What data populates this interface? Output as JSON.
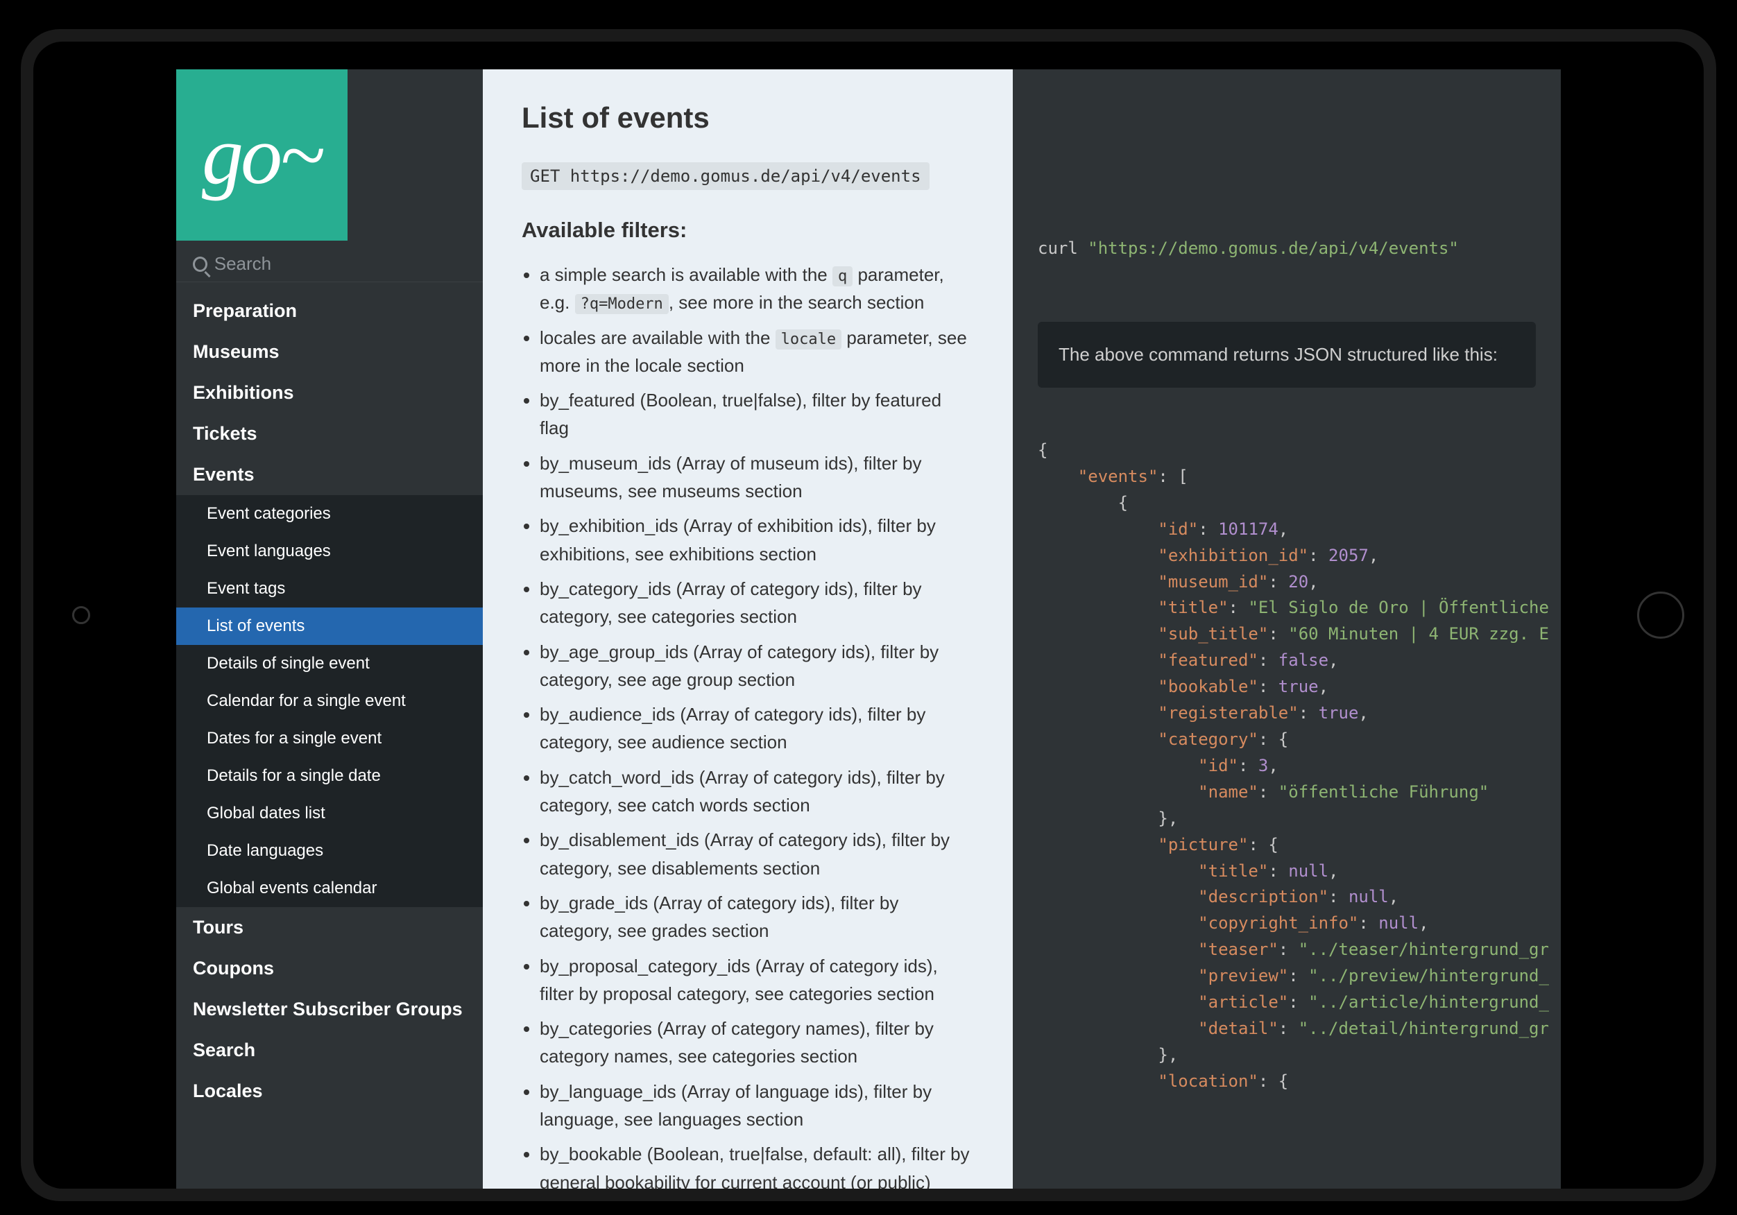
{
  "logo": "go~",
  "search": {
    "placeholder": "Search"
  },
  "nav": {
    "items": [
      {
        "label": "Preparation"
      },
      {
        "label": "Museums"
      },
      {
        "label": "Exhibitions"
      },
      {
        "label": "Tickets"
      },
      {
        "label": "Events",
        "expanded": true,
        "children": [
          {
            "label": "Event categories"
          },
          {
            "label": "Event languages"
          },
          {
            "label": "Event tags"
          },
          {
            "label": "List of events",
            "active": true
          },
          {
            "label": "Details of single event"
          },
          {
            "label": "Calendar for a single event"
          },
          {
            "label": "Dates for a single event"
          },
          {
            "label": "Details for a single date"
          },
          {
            "label": "Global dates list"
          },
          {
            "label": "Date languages"
          },
          {
            "label": "Global events calendar"
          }
        ]
      },
      {
        "label": "Tours"
      },
      {
        "label": "Coupons"
      },
      {
        "label": "Newsletter Subscriber Groups"
      },
      {
        "label": "Search"
      },
      {
        "label": "Locales"
      }
    ]
  },
  "content": {
    "title": "List of events",
    "endpoint": "GET https://demo.gomus.de/api/v4/events",
    "filters_heading": "Available filters:",
    "filters": [
      {
        "html": "a simple search is available with the <code>q</code> parameter, e.g. <code>?q=Modern</code>, see more in the search section"
      },
      {
        "html": "locales are available with the <code>locale</code> parameter, see more in the locale section"
      },
      {
        "html": "by_featured (Boolean, true|false), filter by featured flag"
      },
      {
        "html": "by_museum_ids (Array of museum ids), filter by museums, see museums section"
      },
      {
        "html": "by_exhibition_ids (Array of exhibition ids), filter by exhibitions, see exhibitions section"
      },
      {
        "html": "by_category_ids (Array of category ids), filter by category, see categories section"
      },
      {
        "html": "by_age_group_ids (Array of category ids), filter by category, see age group section"
      },
      {
        "html": "by_audience_ids (Array of category ids), filter by category, see audience section"
      },
      {
        "html": "by_catch_word_ids (Array of category ids), filter by category, see catch words section"
      },
      {
        "html": "by_disablement_ids (Array of category ids), filter by category, see disablements section"
      },
      {
        "html": "by_grade_ids (Array of category ids), filter by category, see grades section"
      },
      {
        "html": "by_proposal_category_ids (Array of category ids), filter by proposal category, see categories section"
      },
      {
        "html": "by_categories (Array of category names), filter by category names, see categories section"
      },
      {
        "html": "by_language_ids (Array of language ids), filter by language, see languages section"
      },
      {
        "html": "by_bookable (Boolean, true|false, default: all), filter by general bookability for current account (or public)"
      }
    ]
  },
  "code": {
    "curl_cmd": "curl ",
    "curl_url": "\"https://demo.gomus.de/api/v4/events\"",
    "note": "The above command returns JSON structured like this:",
    "json_tokens": [
      {
        "t": "{",
        "c": "p"
      },
      {
        "nl": 1
      },
      {
        "i": 4
      },
      {
        "t": "\"events\"",
        "c": "k"
      },
      {
        "t": ": [",
        "c": "p"
      },
      {
        "nl": 1
      },
      {
        "i": 8
      },
      {
        "t": "{",
        "c": "p"
      },
      {
        "nl": 1
      },
      {
        "i": 12
      },
      {
        "t": "\"id\"",
        "c": "k"
      },
      {
        "t": ": ",
        "c": "p"
      },
      {
        "t": "101174",
        "c": "n"
      },
      {
        "t": ",",
        "c": "p"
      },
      {
        "nl": 1
      },
      {
        "i": 12
      },
      {
        "t": "\"exhibition_id\"",
        "c": "k"
      },
      {
        "t": ": ",
        "c": "p"
      },
      {
        "t": "2057",
        "c": "n"
      },
      {
        "t": ",",
        "c": "p"
      },
      {
        "nl": 1
      },
      {
        "i": 12
      },
      {
        "t": "\"museum_id\"",
        "c": "k"
      },
      {
        "t": ": ",
        "c": "p"
      },
      {
        "t": "20",
        "c": "n"
      },
      {
        "t": ",",
        "c": "p"
      },
      {
        "nl": 1
      },
      {
        "i": 12
      },
      {
        "t": "\"title\"",
        "c": "k"
      },
      {
        "t": ": ",
        "c": "p"
      },
      {
        "t": "\"El Siglo de Oro | Öffentliche",
        "c": "s"
      },
      {
        "nl": 1
      },
      {
        "i": 12
      },
      {
        "t": "\"sub_title\"",
        "c": "k"
      },
      {
        "t": ": ",
        "c": "p"
      },
      {
        "t": "\"60 Minuten | 4 EUR zzg. E",
        "c": "s"
      },
      {
        "nl": 1
      },
      {
        "i": 12
      },
      {
        "t": "\"featured\"",
        "c": "k"
      },
      {
        "t": ": ",
        "c": "p"
      },
      {
        "t": "false",
        "c": "b"
      },
      {
        "t": ",",
        "c": "p"
      },
      {
        "nl": 1
      },
      {
        "i": 12
      },
      {
        "t": "\"bookable\"",
        "c": "k"
      },
      {
        "t": ": ",
        "c": "p"
      },
      {
        "t": "true",
        "c": "b"
      },
      {
        "t": ",",
        "c": "p"
      },
      {
        "nl": 1
      },
      {
        "i": 12
      },
      {
        "t": "\"registerable\"",
        "c": "k"
      },
      {
        "t": ": ",
        "c": "p"
      },
      {
        "t": "true",
        "c": "b"
      },
      {
        "t": ",",
        "c": "p"
      },
      {
        "nl": 1
      },
      {
        "i": 12
      },
      {
        "t": "\"category\"",
        "c": "k"
      },
      {
        "t": ": {",
        "c": "p"
      },
      {
        "nl": 1
      },
      {
        "i": 16
      },
      {
        "t": "\"id\"",
        "c": "k"
      },
      {
        "t": ": ",
        "c": "p"
      },
      {
        "t": "3",
        "c": "n"
      },
      {
        "t": ",",
        "c": "p"
      },
      {
        "nl": 1
      },
      {
        "i": 16
      },
      {
        "t": "\"name\"",
        "c": "k"
      },
      {
        "t": ": ",
        "c": "p"
      },
      {
        "t": "\"öffentliche Führung\"",
        "c": "s"
      },
      {
        "nl": 1
      },
      {
        "i": 12
      },
      {
        "t": "},",
        "c": "p"
      },
      {
        "nl": 1
      },
      {
        "i": 12
      },
      {
        "t": "\"picture\"",
        "c": "k"
      },
      {
        "t": ": {",
        "c": "p"
      },
      {
        "nl": 1
      },
      {
        "i": 16
      },
      {
        "t": "\"title\"",
        "c": "k"
      },
      {
        "t": ": ",
        "c": "p"
      },
      {
        "t": "null",
        "c": "u"
      },
      {
        "t": ",",
        "c": "p"
      },
      {
        "nl": 1
      },
      {
        "i": 16
      },
      {
        "t": "\"description\"",
        "c": "k"
      },
      {
        "t": ": ",
        "c": "p"
      },
      {
        "t": "null",
        "c": "u"
      },
      {
        "t": ",",
        "c": "p"
      },
      {
        "nl": 1
      },
      {
        "i": 16
      },
      {
        "t": "\"copyright_info\"",
        "c": "k"
      },
      {
        "t": ": ",
        "c": "p"
      },
      {
        "t": "null",
        "c": "u"
      },
      {
        "t": ",",
        "c": "p"
      },
      {
        "nl": 1
      },
      {
        "i": 16
      },
      {
        "t": "\"teaser\"",
        "c": "k"
      },
      {
        "t": ": ",
        "c": "p"
      },
      {
        "t": "\"../teaser/hintergrund_gr",
        "c": "s"
      },
      {
        "nl": 1
      },
      {
        "i": 16
      },
      {
        "t": "\"preview\"",
        "c": "k"
      },
      {
        "t": ": ",
        "c": "p"
      },
      {
        "t": "\"../preview/hintergrund_",
        "c": "s"
      },
      {
        "nl": 1
      },
      {
        "i": 16
      },
      {
        "t": "\"article\"",
        "c": "k"
      },
      {
        "t": ": ",
        "c": "p"
      },
      {
        "t": "\"../article/hintergrund_",
        "c": "s"
      },
      {
        "nl": 1
      },
      {
        "i": 16
      },
      {
        "t": "\"detail\"",
        "c": "k"
      },
      {
        "t": ": ",
        "c": "p"
      },
      {
        "t": "\"../detail/hintergrund_gr",
        "c": "s"
      },
      {
        "nl": 1
      },
      {
        "i": 12
      },
      {
        "t": "},",
        "c": "p"
      },
      {
        "nl": 1
      },
      {
        "i": 12
      },
      {
        "t": "\"location\"",
        "c": "k"
      },
      {
        "t": ": {",
        "c": "p"
      }
    ]
  }
}
